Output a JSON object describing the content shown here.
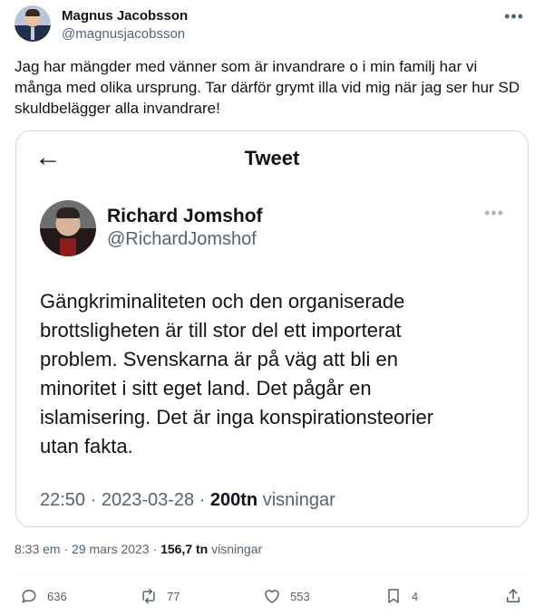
{
  "author": {
    "name": "Magnus Jacobsson",
    "handle": "@magnusjacobsson",
    "more_icon": "more-horizontal-icon"
  },
  "post": {
    "text": "Jag har mängder med vänner som är invandrare o i min familj har vi\nmånga med olika ursprung. Tar därför grymt illa vid mig när jag ser hur SD\nskuldbelägger alla invandrare!"
  },
  "quoted": {
    "back_icon": "arrow-left-icon",
    "title": "Tweet",
    "name": "Richard Jomshof",
    "handle": "@RichardJomshof",
    "text": "Gängkriminaliteten och den organiserade\nbrottsligheten är till stor del ett importerat\nproblem. Svenskarna är på väg att bli en\nminoritet i sitt eget land. Det pågår en\nislamisering. Det är inga konspirationsteorier\nutan fakta.",
    "time": "22:50 · 2023-03-28 · ",
    "views": "200tn",
    "views_label": " visningar"
  },
  "meta": {
    "time": "8:33 em · 29 mars 2023 · ",
    "views": "156,7 tn",
    "views_label": " visningar"
  },
  "actions": {
    "replies": "636",
    "reposts": "77",
    "likes": "553",
    "bookmarks": "4",
    "icons": [
      "reply-icon",
      "repost-icon",
      "like-icon",
      "bookmark-icon",
      "share-icon"
    ]
  }
}
